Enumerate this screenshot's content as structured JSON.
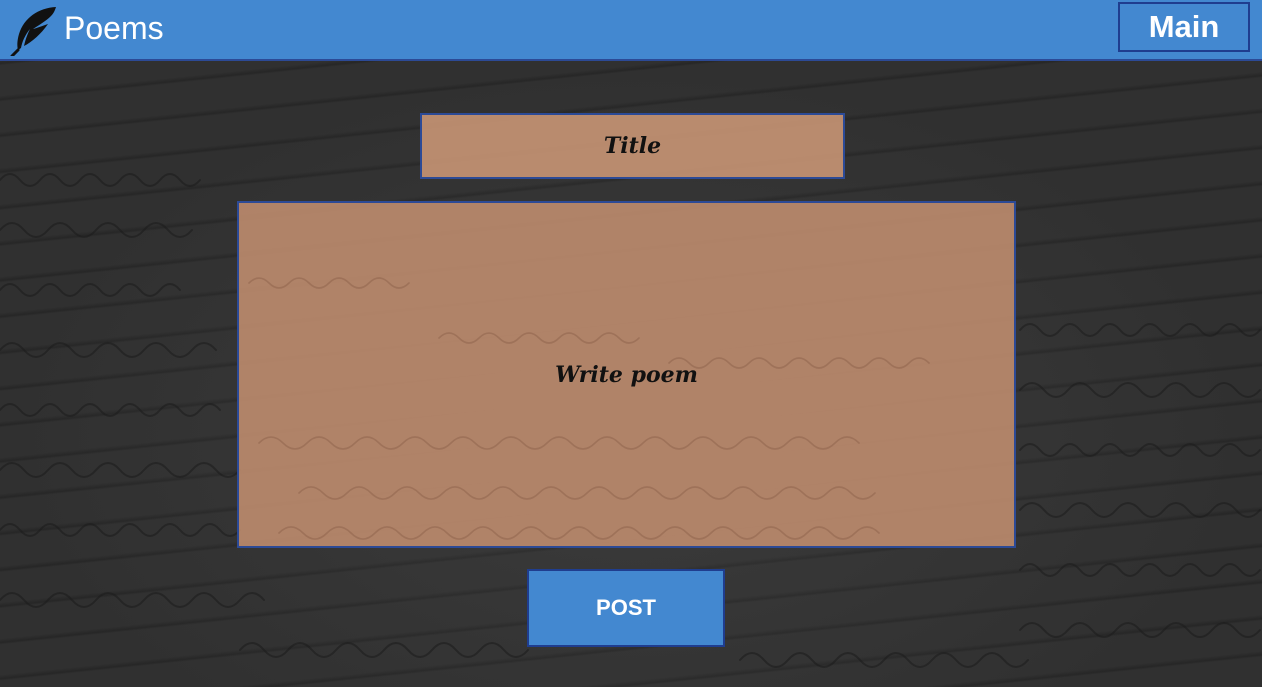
{
  "header": {
    "logo_icon": "feather-quill-icon",
    "brand_title": "Poems",
    "main_label": "Main"
  },
  "form": {
    "title_placeholder": "Title",
    "poem_placeholder": "Write poem",
    "post_label": "POST"
  },
  "colors": {
    "header_bg": "#4388d0",
    "border_accent": "#2c4a96",
    "field_bg": "#c49273",
    "page_bg": "#2e2e2e"
  }
}
